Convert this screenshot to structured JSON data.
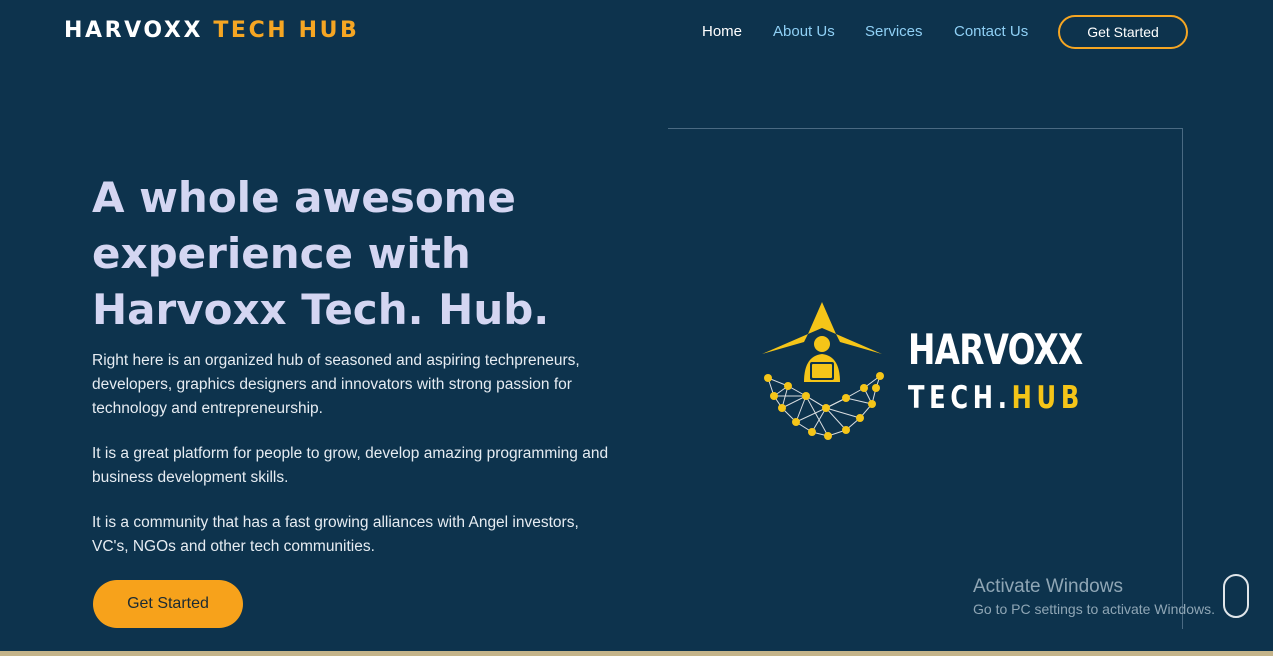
{
  "brand": {
    "part1": "HARVOXX",
    "part2": "TECH HUB"
  },
  "nav": {
    "links": [
      {
        "label": "Home",
        "active": true
      },
      {
        "label": "About Us",
        "active": false
      },
      {
        "label": "Services",
        "active": false
      },
      {
        "label": "Contact Us",
        "active": false
      }
    ],
    "cta_label": "Get Started"
  },
  "hero": {
    "title": "A whole awesome experience with Harvoxx Tech. Hub.",
    "paragraphs": [
      "Right here is an organized hub of seasoned and aspiring techpreneurs, developers, graphics designers and innovators with strong passion for technology and entrepreneurship.",
      "It is a great platform for people to grow, develop amazing programming and business development skills.",
      "It is a community that has a fast growing alliances with Angel investors, VC's, NGOs and other tech communities."
    ],
    "cta_label": "Get Started"
  },
  "logo": {
    "line1": "HARVOXX",
    "line2a": "TECH.",
    "line2b": "HUB"
  },
  "watermark": {
    "title": "Activate Windows",
    "subtitle": "Go to PC settings to activate Windows."
  },
  "colors": {
    "background": "#0d334d",
    "accent": "#f5a623",
    "link": "#8fd0f5",
    "logo_yellow": "#f5c518"
  }
}
